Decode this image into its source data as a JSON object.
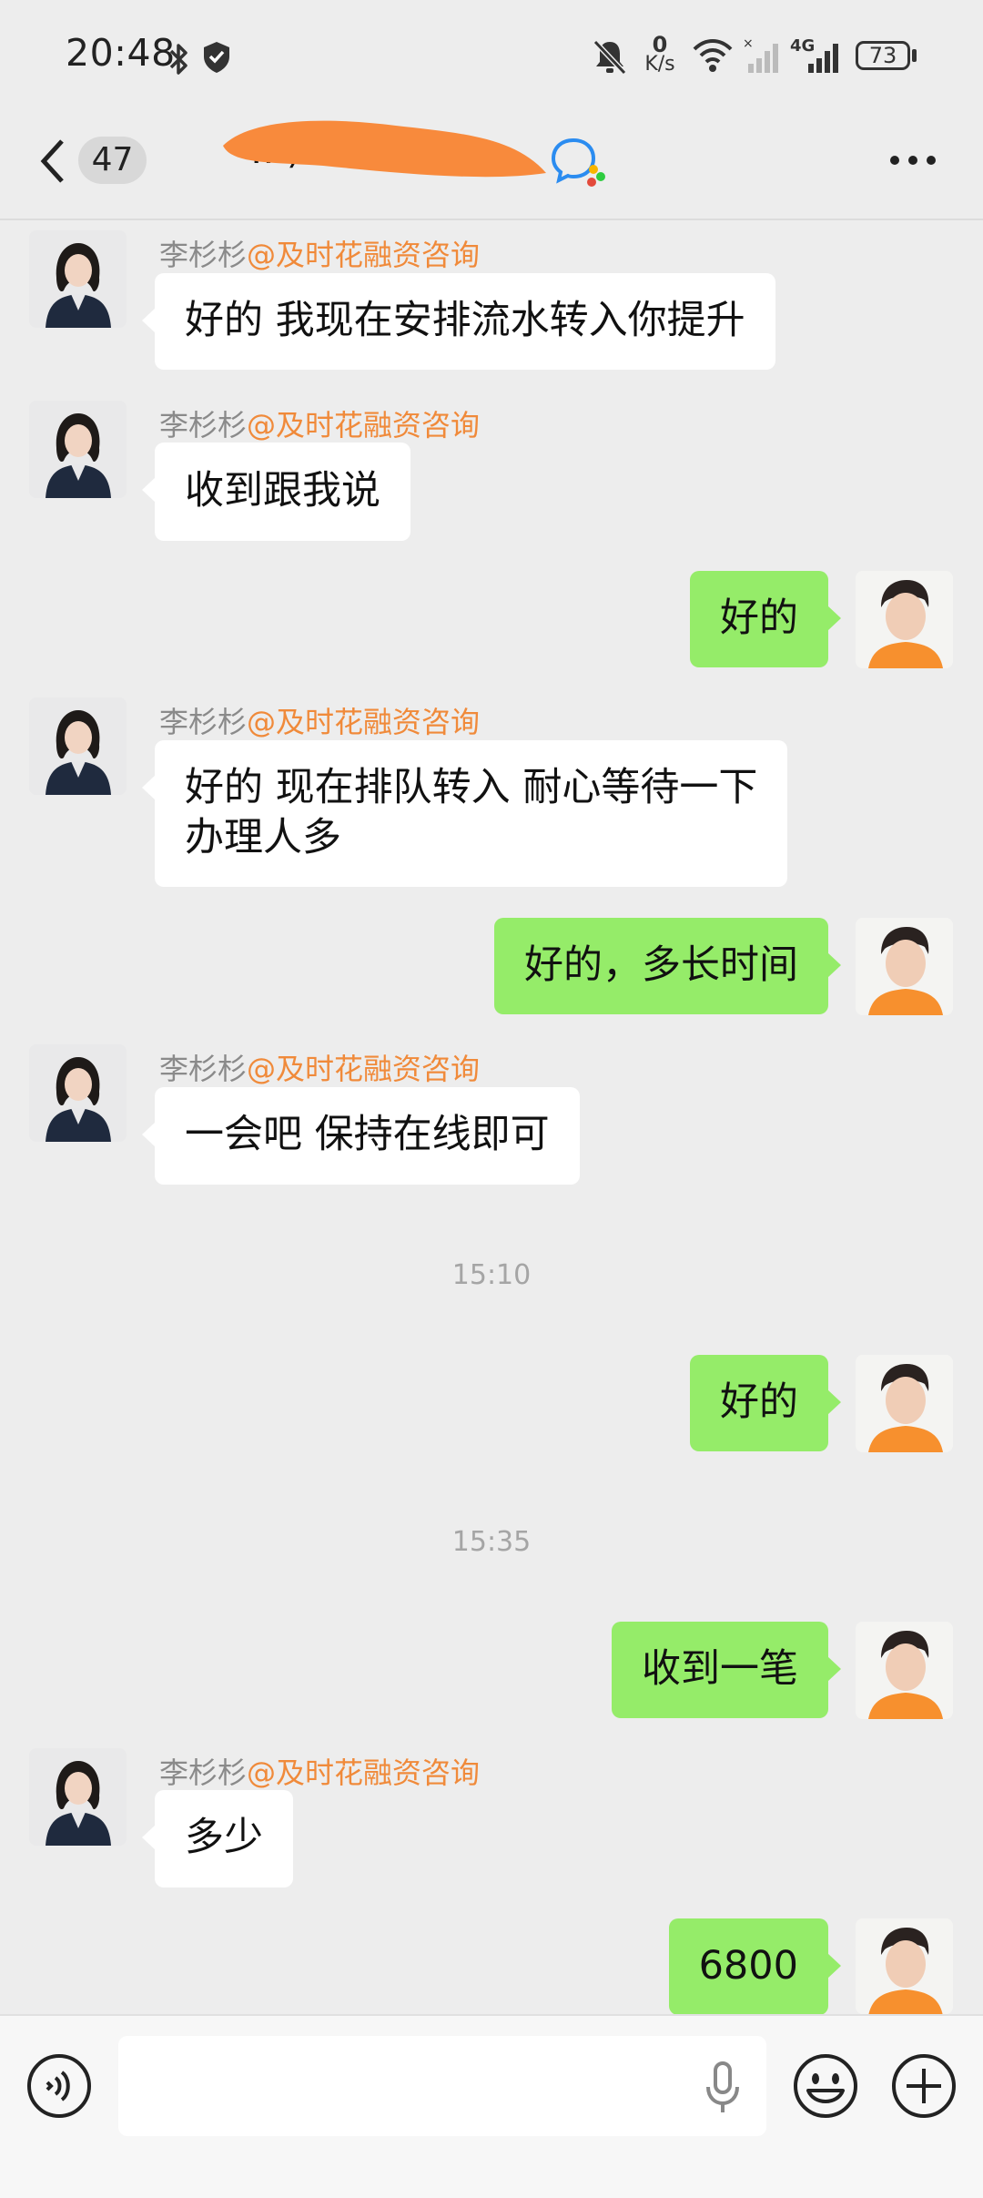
{
  "status_bar": {
    "time": "20:48",
    "net_speed_value": "0",
    "net_speed_unit": "K/s",
    "network": "4G",
    "battery": "73"
  },
  "header": {
    "back_count": "47",
    "title": "…)"
  },
  "messages": [
    {
      "dir": "in",
      "sender": "李杉杉",
      "corp": "@及时花融资咨询",
      "text": [
        "好的 我现在安排流水转入你提升"
      ]
    },
    {
      "dir": "in",
      "sender": "李杉杉",
      "corp": "@及时花融资咨询",
      "text": [
        "收到跟我说"
      ]
    },
    {
      "dir": "out",
      "text": [
        "好的"
      ]
    },
    {
      "dir": "in",
      "sender": "李杉杉",
      "corp": "@及时花融资咨询",
      "text": [
        "好的 现在排队转入 耐心等待一下",
        "办理人多"
      ]
    },
    {
      "dir": "out",
      "text": [
        "好的，多长时间"
      ]
    },
    {
      "dir": "in",
      "sender": "李杉杉",
      "corp": "@及时花融资咨询",
      "text": [
        "一会吧  保持在线即可"
      ]
    },
    {
      "dir": "time",
      "text": [
        "15:10"
      ]
    },
    {
      "dir": "out",
      "text": [
        "好的"
      ]
    },
    {
      "dir": "time",
      "text": [
        "15:35"
      ]
    },
    {
      "dir": "out",
      "text": [
        "收到一笔"
      ]
    },
    {
      "dir": "in",
      "sender": "李杉杉",
      "corp": "@及时花融资咨询",
      "text": [
        "多少"
      ]
    },
    {
      "dir": "out",
      "text": [
        "6800"
      ]
    }
  ],
  "input": {
    "value": "",
    "placeholder": ""
  },
  "colors": {
    "background": "#ededed",
    "outgoing_bubble": "#95ec69",
    "incoming_bubble": "#ffffff",
    "corp_label": "#f08a3a",
    "redaction": "#f88a3c"
  },
  "icons": [
    "back-icon",
    "bluetooth-icon",
    "shield-icon",
    "mute-icon",
    "wifi-icon",
    "signal-icon",
    "battery-icon",
    "wecom-icon",
    "more-icon",
    "voice-icon",
    "microphone-icon",
    "emoji-icon",
    "plus-icon"
  ]
}
